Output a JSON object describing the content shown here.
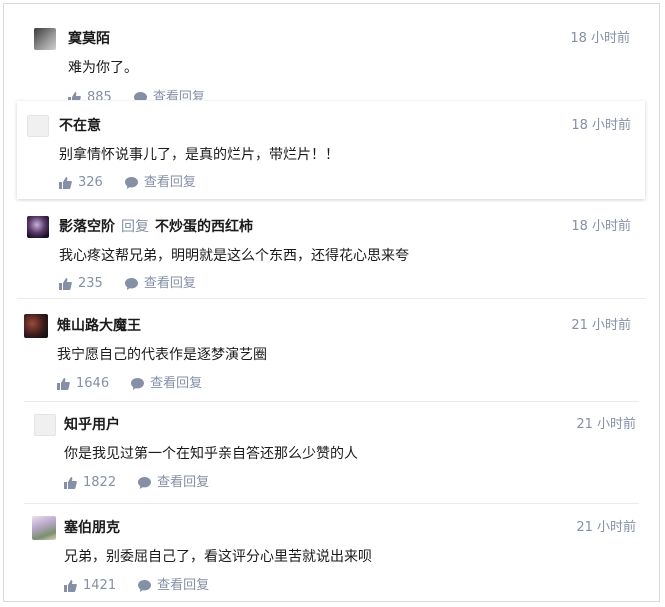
{
  "comments": [
    {
      "name": "寞莫陌",
      "time": "18 小时前",
      "text": "难为你了。",
      "likes": "885",
      "view_reply": "查看回复"
    },
    {
      "name": "不在意",
      "time": "18 小时前",
      "text": "别拿情怀说事儿了，是真的烂片，带烂片！！",
      "likes": "326",
      "view_reply": "查看回复"
    },
    {
      "name": "影落空阶",
      "reply_word": "回复",
      "reply_to": "不炒蛋的西红柿",
      "time": "18 小时前",
      "text": "我心疼这帮兄弟，明明就是这么个东西，还得花心思来夸",
      "likes": "235",
      "view_reply": "查看回复"
    },
    {
      "name": "雉山路大魔王",
      "time": "21 小时前",
      "text": "我宁愿自己的代表作是逐梦演艺圈",
      "likes": "1646",
      "view_reply": "查看回复"
    },
    {
      "name": "知乎用户",
      "time": "21 小时前",
      "text": "你是我见过第一个在知乎亲自答还那么少赞的人",
      "likes": "1822",
      "view_reply": "查看回复"
    },
    {
      "name": "塞伯朋克",
      "time": "21 小时前",
      "text": "兄弟，别委屈自己了，看这评分心里苦就说出来呗",
      "likes": "1421",
      "view_reply": "查看回复"
    }
  ],
  "colors": {
    "meta": "#8590a6",
    "text": "#1a1a1a",
    "border": "#d9d9d9"
  }
}
